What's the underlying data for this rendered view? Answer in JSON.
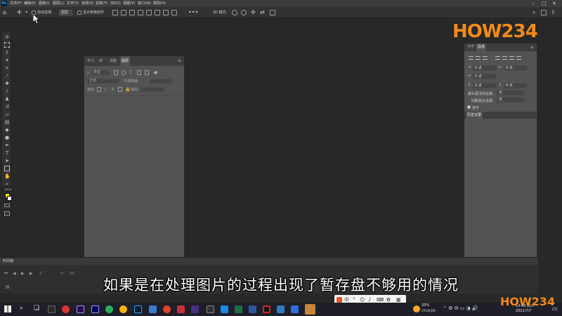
{
  "menu": {
    "items": [
      "文件(F)",
      "编辑(E)",
      "图像(I)",
      "图层(L)",
      "文字(Y)",
      "选择(S)",
      "滤镜(T)",
      "3D(D)",
      "视图(V)",
      "窗口(W)",
      "帮助(H)"
    ]
  },
  "options_bar": {
    "auto_select_label": "自动选择:",
    "auto_select_value": "图层",
    "show_transform_label": "显示变换控件",
    "mode_label": "3D 模式:"
  },
  "layers_panel": {
    "tabs": [
      "学习",
      "库",
      "调整",
      "图层"
    ],
    "active_tab": "图层",
    "kind_filter": "类型",
    "blend_mode": "正常",
    "opacity_label": "不透明度:",
    "lock_label": "锁定:",
    "fill_label": "填充:"
  },
  "right_panel": {
    "tabs": [
      "字符",
      "段落"
    ],
    "active_tab": "段落",
    "indent_left": "0 点",
    "indent_right": "0 点",
    "first_line": "0 点",
    "space_before": "0 点",
    "space_after": "0 点",
    "avoid_label": "避头尾法则设置:",
    "avoid_value": "无",
    "spacing_label": "间距组合设置:",
    "spacing_value": "无",
    "hyphenate_label": "连字",
    "history_tab": "历史记录"
  },
  "timeline": {
    "title": "时间轴"
  },
  "subtitle": "如果是在处理图片的过程出现了暂存盘不够用的情况",
  "logo_text": "HOW234",
  "taskbar": {
    "time": "14:40 周三",
    "date": "2021/7/7",
    "cpu_label": "33%",
    "cpu_sub": "CPU利用率"
  },
  "ime": {
    "label": "中"
  },
  "colors": {
    "foreground": "#ffea00",
    "background": "#ffffff",
    "logo_orange": "#f28a1a",
    "logo_purple": "#8a3fd1",
    "logo_green": "#4bc54b"
  }
}
